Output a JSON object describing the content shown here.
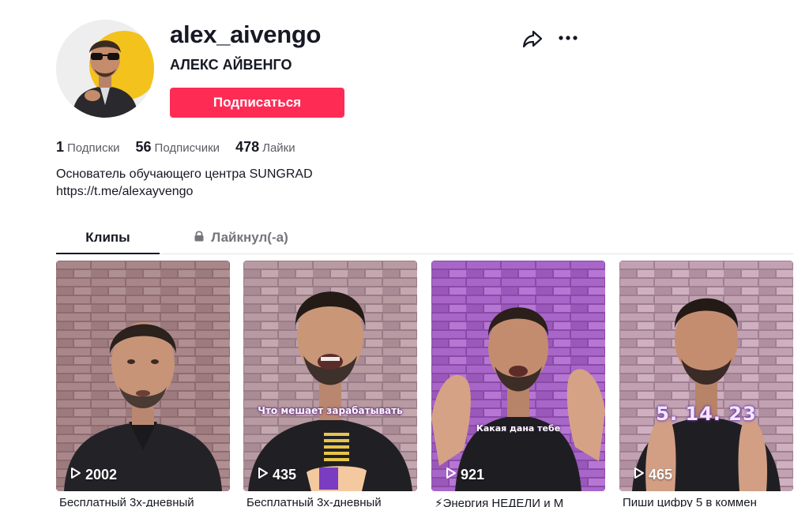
{
  "profile": {
    "username": "alex_aivengo",
    "nickname": "АЛЕКС АЙВЕНГО",
    "follow_label": "Подписаться"
  },
  "stats": [
    {
      "value": "1",
      "label": "Подписки"
    },
    {
      "value": "56",
      "label": "Подписчики"
    },
    {
      "value": "478",
      "label": "Лайки"
    }
  ],
  "bio": {
    "line1": "Основатель обучающего центра SUNGRAD",
    "link": "https://t.me/alexayvengo"
  },
  "tabs": [
    {
      "label": "Клипы",
      "active": true
    },
    {
      "label": "Лайкнул(-а)",
      "active": false,
      "icon": "lock-icon"
    }
  ],
  "videos": [
    {
      "views": "2002",
      "title": "Бесплатный 3х-дневный",
      "overlay": ""
    },
    {
      "views": "435",
      "title": "Бесплатный 3х-дневный",
      "overlay": "Что мешает зарабатывать"
    },
    {
      "views": "921",
      "title": "⚡Энергия НЕДЕЛИ и М",
      "overlay": "Какая дана тебе"
    },
    {
      "views": "465",
      "title": "Пиши цифру 5 в коммен",
      "overlay": "5. 14. 23"
    }
  ],
  "icons": [
    "share-icon",
    "more-icon",
    "lock-icon",
    "play-icon"
  ],
  "colors": {
    "accent": "#fe2c55",
    "text": "#161823",
    "muted": "#74757b"
  }
}
